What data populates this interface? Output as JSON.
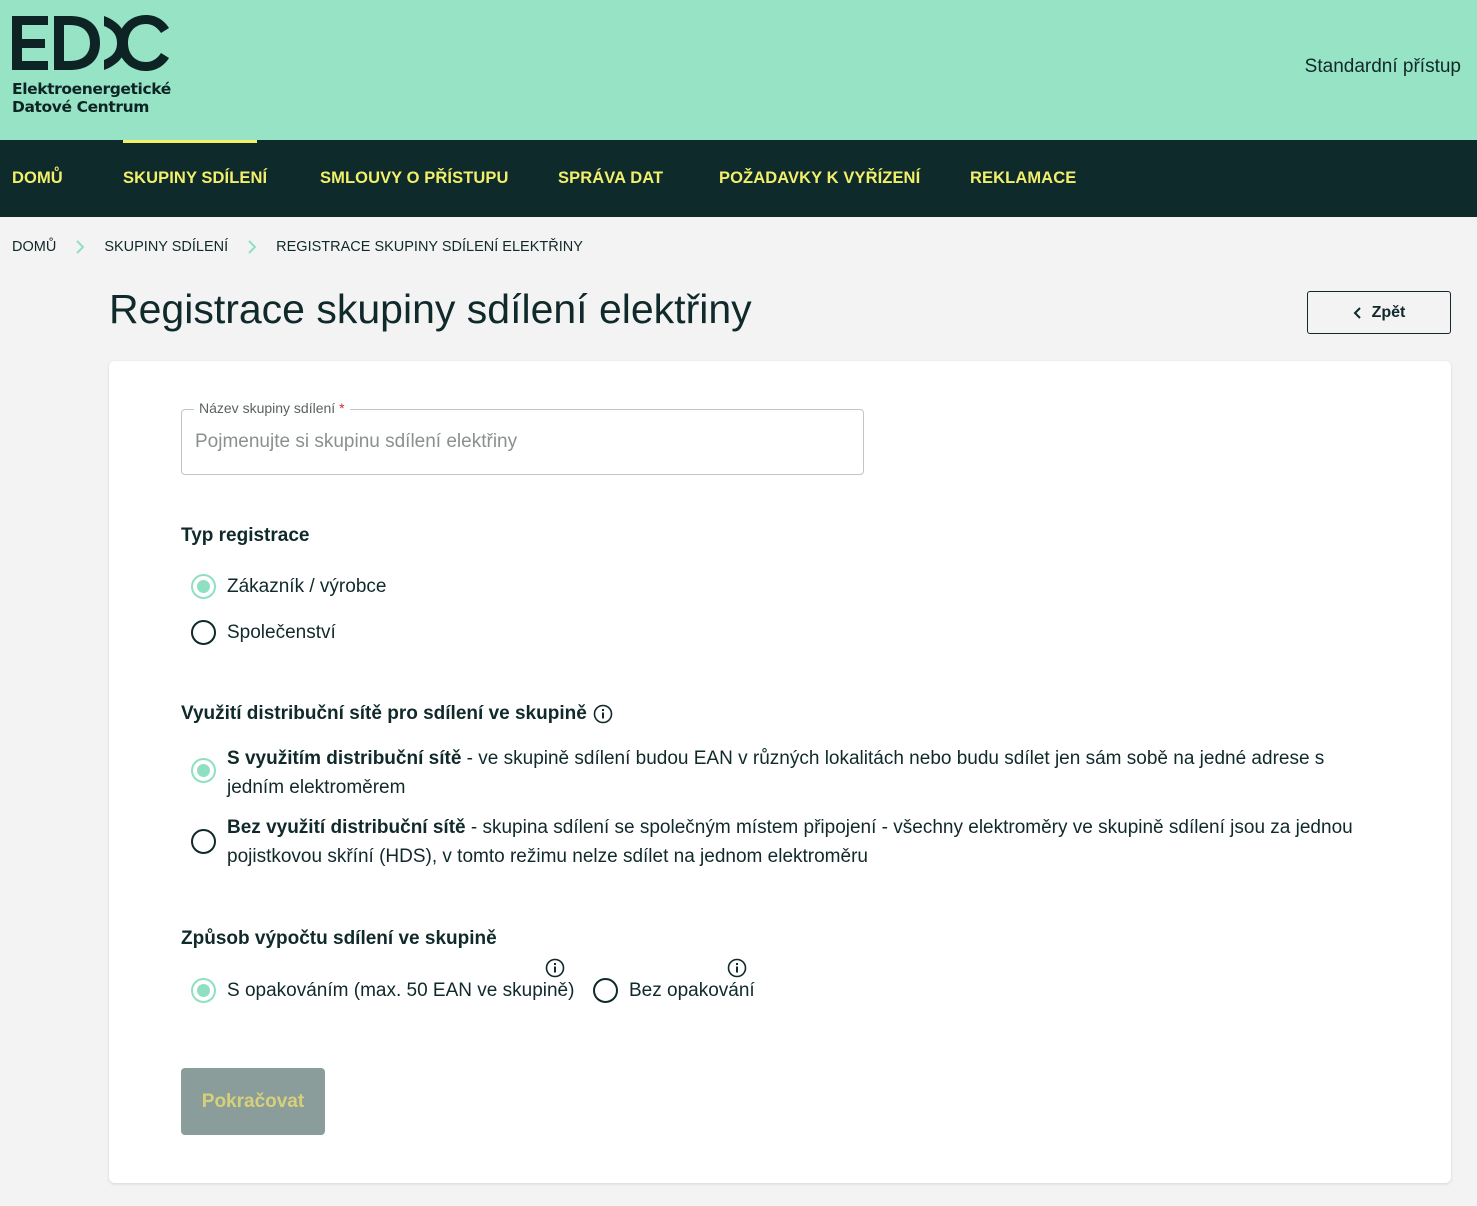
{
  "header": {
    "logo_mark": "EDC",
    "logo_line1": "Elektroenergetické",
    "logo_line2": "Datové Centrum",
    "access_label": "Standardní přístup",
    "colors": {
      "header_bg": "#96e4c5",
      "nav_bg": "#0f2a2b",
      "nav_text": "#f2ef6a"
    }
  },
  "nav": {
    "items": [
      {
        "label": "DOMŮ",
        "active": false
      },
      {
        "label": "SKUPINY SDÍLENÍ",
        "active": true
      },
      {
        "label": "SMLOUVY O PŘÍSTUPU",
        "active": false
      },
      {
        "label": "SPRÁVA DAT",
        "active": false
      },
      {
        "label": "POŽADAVKY K VYŘÍZENÍ",
        "active": false
      },
      {
        "label": "REKLAMACE",
        "active": false
      }
    ]
  },
  "breadcrumb": {
    "items": [
      "DOMŮ",
      "SKUPINY SDÍLENÍ",
      "REGISTRACE SKUPINY SDÍLENÍ ELEKTŘINY"
    ],
    "separator_icon": "chevron-right-icon"
  },
  "page": {
    "title": "Registrace skupiny sdílení elektřiny",
    "back_label": "Zpět",
    "back_icon": "chevron-left-icon"
  },
  "form": {
    "name_field": {
      "label": "Název skupiny sdílení",
      "required_mark": "*",
      "placeholder": "Pojmenujte si skupinu sdílení elektřiny",
      "value": ""
    },
    "registration_type": {
      "title": "Typ registrace",
      "options": [
        {
          "label": "Zákazník / výrobce",
          "checked": true
        },
        {
          "label": "Společenství",
          "checked": false
        }
      ]
    },
    "network_usage": {
      "title": "Využití distribuční sítě pro sdílení ve skupině",
      "info_icon": "info-icon",
      "options": [
        {
          "bold": "S využitím distribuční sítě",
          "text": " - ve skupině sdílení budou EAN v různých lokalitách nebo budu sdílet jen sám sobě na jedné adrese s jedním elektroměrem",
          "checked": true
        },
        {
          "bold": "Bez využití distribuční sítě",
          "text": " - skupina sdílení se společným místem připojení - všechny elektroměry ve skupině sdílení jsou za jednou pojistkovou skříní (HDS), v tomto režimu nelze sdílet na jednom elektroměru",
          "checked": false
        }
      ]
    },
    "calculation": {
      "title": "Způsob výpočtu sdílení ve skupině",
      "options": [
        {
          "label": "S opakováním (max. 50 EAN ve skupině)",
          "checked": true,
          "info_icon": "info-icon"
        },
        {
          "label": "Bez opakování",
          "checked": false,
          "info_icon": "info-icon"
        }
      ]
    },
    "continue_label": "Pokračovat",
    "continue_disabled": true
  }
}
